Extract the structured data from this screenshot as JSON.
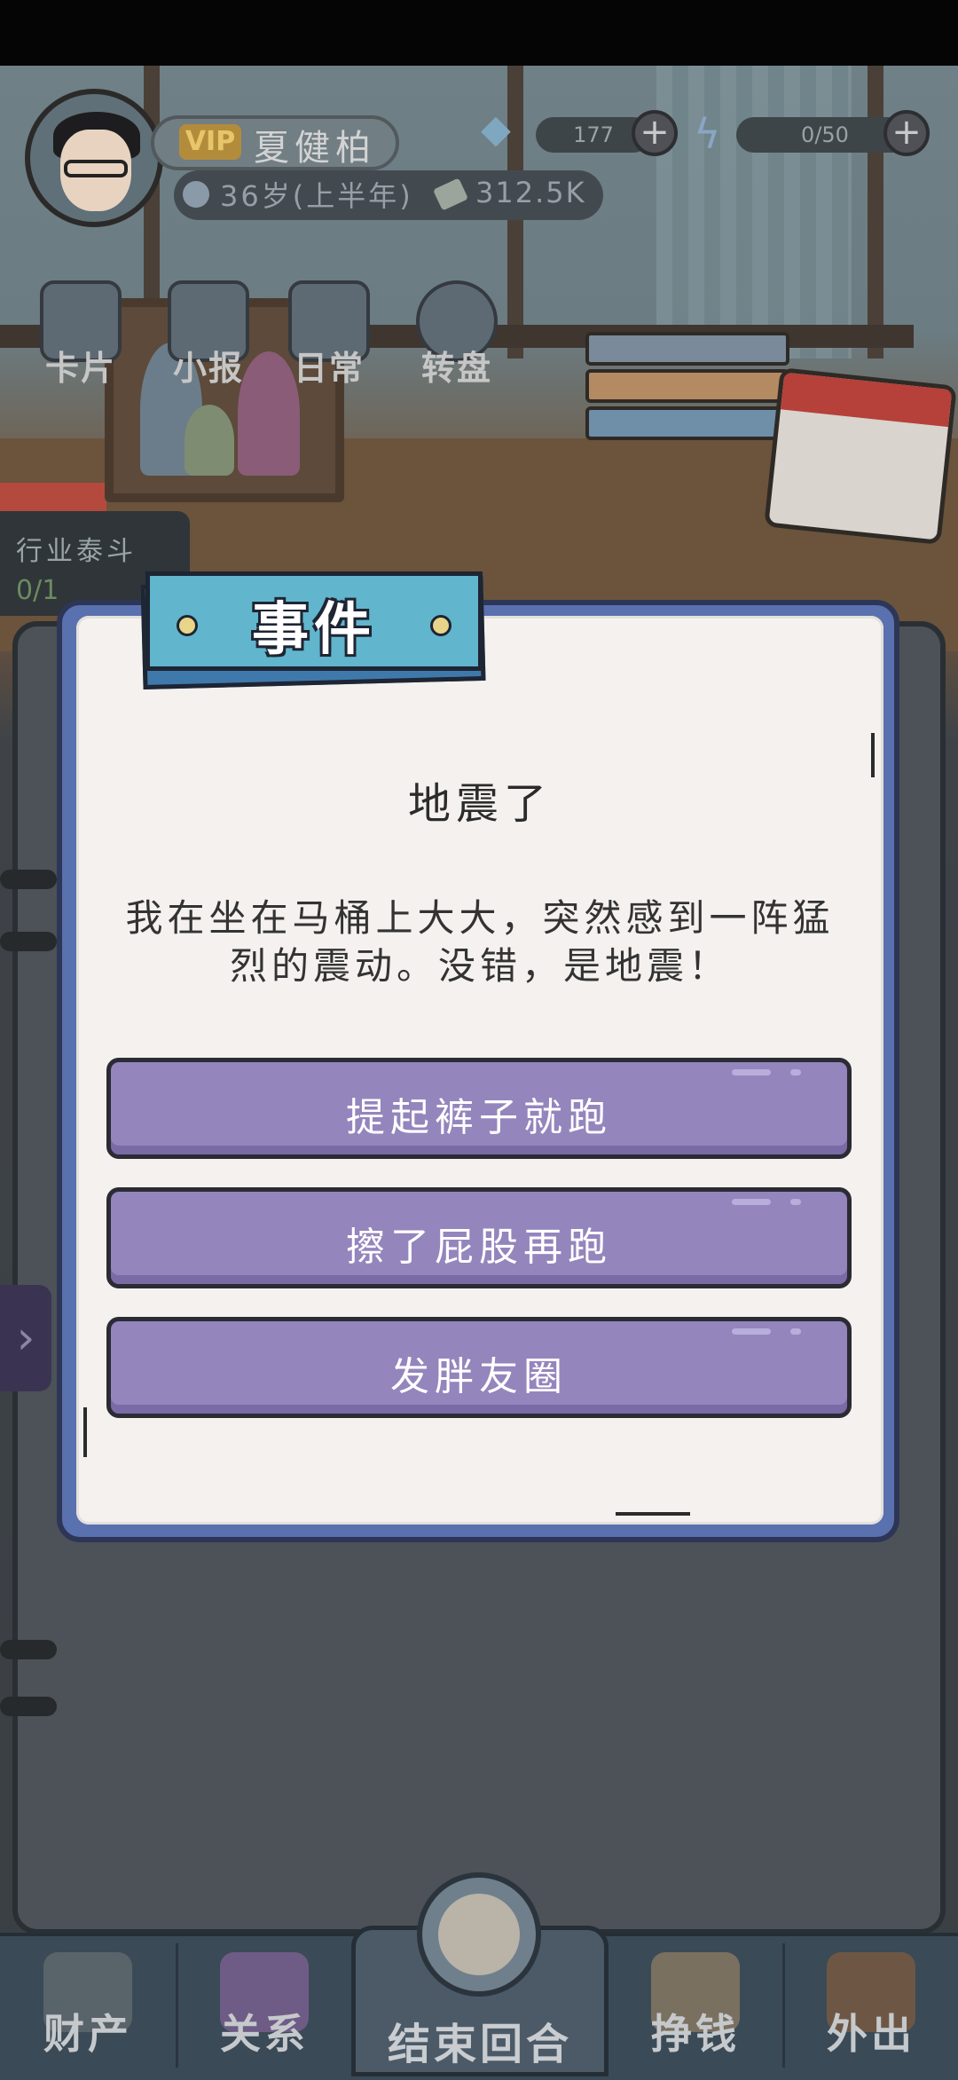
{
  "hud": {
    "vip_label": "VIP",
    "player_name": "夏健柏",
    "age_text": "36岁(上半年)",
    "money_text": "312.5K",
    "gems_text": "177",
    "energy_text": "0/50"
  },
  "quick_menu": [
    {
      "label": "卡片"
    },
    {
      "label": "小报"
    },
    {
      "label": "日常"
    },
    {
      "label": "转盘"
    }
  ],
  "side_badge": {
    "title": "行业泰斗",
    "value": "0/1"
  },
  "event": {
    "tag": "事件",
    "title": "地震了",
    "description": "我在坐在马桶上大大，突然感到一阵猛烈的震动。没错，是地震！",
    "choices": [
      {
        "label": "提起裤子就跑"
      },
      {
        "label": "擦了屁股再跑"
      },
      {
        "label": "发胖友圈"
      }
    ]
  },
  "bottom_nav": {
    "assets": "财产",
    "relations": "关系",
    "end_turn": "结束回合",
    "earn": "挣钱",
    "go_out": "外出"
  },
  "colors": {
    "choice_button": "#9485bd",
    "modal_frame": "#5a71b0",
    "tag": "#61b5cc"
  },
  "icons": [
    "avatar",
    "diamond-icon",
    "lightning-icon",
    "plus-icon",
    "clock-icon",
    "money-icon",
    "chevron-right-icon",
    "alarm-clock-icon",
    "house-icon",
    "contacts-book-icon",
    "fist-money-icon",
    "door-icon"
  ]
}
